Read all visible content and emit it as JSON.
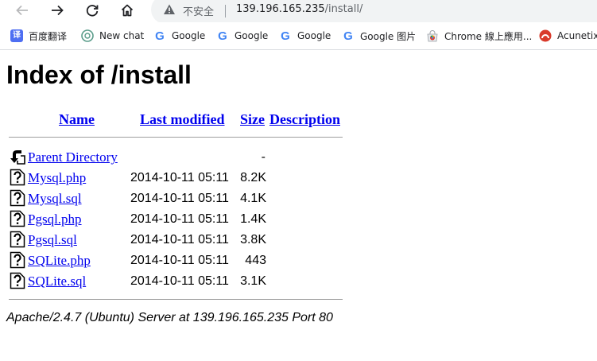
{
  "browser": {
    "security_label": "不安全",
    "url_host": "139.196.165.235",
    "url_path": "/install/",
    "icons": {
      "back": "arrow-left-icon",
      "forward": "arrow-right-icon",
      "reload": "reload-icon",
      "home": "home-icon",
      "security": "warning-triangle-icon"
    }
  },
  "bookmarks": [
    {
      "label": "百度翻译",
      "icon": "baidu-translate-icon"
    },
    {
      "label": "New chat",
      "icon": "openai-icon"
    },
    {
      "label": "Google",
      "icon": "google-icon"
    },
    {
      "label": "Google",
      "icon": "google-icon"
    },
    {
      "label": "Google",
      "icon": "google-icon"
    },
    {
      "label": "Google 图片",
      "icon": "google-icon"
    },
    {
      "label": "Chrome 線上應用...",
      "icon": "chrome-web-store-icon"
    },
    {
      "label": "Acunetix",
      "icon": "acunetix-icon"
    }
  ],
  "page": {
    "title": "Index of /install",
    "columns": {
      "name": "Name",
      "last_modified": "Last modified",
      "size": "Size",
      "description": "Description"
    },
    "parent": {
      "name": "Parent Directory",
      "size": "-"
    },
    "files": [
      {
        "name": "Mysql.php",
        "modified": "2014-10-11 05:11",
        "size": "8.2K"
      },
      {
        "name": "Mysql.sql",
        "modified": "2014-10-11 05:11",
        "size": "4.1K"
      },
      {
        "name": "Pgsql.php",
        "modified": "2014-10-11 05:11",
        "size": "1.4K"
      },
      {
        "name": "Pgsql.sql",
        "modified": "2014-10-11 05:11",
        "size": "3.8K"
      },
      {
        "name": "SQLite.php",
        "modified": "2014-10-11 05:11",
        "size": "443"
      },
      {
        "name": "SQLite.sql",
        "modified": "2014-10-11 05:11",
        "size": "3.1K"
      }
    ],
    "server_signature": "Apache/2.4.7 (Ubuntu) Server at 139.196.165.235 Port 80"
  },
  "colors": {
    "link": "#0000ee",
    "omnibox_bg": "#f1f3f4",
    "rule": "#9e9e9e"
  }
}
